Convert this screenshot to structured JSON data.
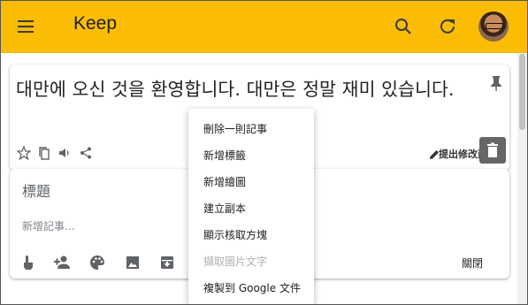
{
  "app": {
    "title": "Keep"
  },
  "note": {
    "body": "대만에 오신 것을 환영합니다. 대만은 정말 재미 있습니다.",
    "edit_label": "提出修改建議"
  },
  "new_note": {
    "title_placeholder": "標題",
    "body_placeholder": "新增記事...",
    "close_label": "關閉"
  },
  "context_menu": {
    "items": [
      {
        "label": "刪除一則記事",
        "enabled": true
      },
      {
        "label": "新增標籤",
        "enabled": true
      },
      {
        "label": "新增繪圖",
        "enabled": true
      },
      {
        "label": "建立副本",
        "enabled": true
      },
      {
        "label": "顯示核取方塊",
        "enabled": true
      },
      {
        "label": "擷取圖片文字",
        "enabled": false
      },
      {
        "label": "複製到 Google 文件",
        "enabled": true
      }
    ]
  },
  "icons": {
    "menu": "hamburger-menu-icon",
    "search": "search-icon",
    "refresh": "refresh-icon",
    "pin": "pin-icon",
    "star": "star-icon",
    "copy": "copy-icon",
    "speaker": "speaker-icon",
    "share": "share-icon",
    "edit": "pencil-icon",
    "trash": "trash-icon",
    "reminder": "reminder-icon",
    "collaborator": "add-collaborator-icon",
    "palette": "palette-icon",
    "image": "image-icon",
    "archive": "archive-icon"
  },
  "colors": {
    "appbar": "#fbbc04",
    "text": "#202124",
    "muted": "#5f6368"
  }
}
